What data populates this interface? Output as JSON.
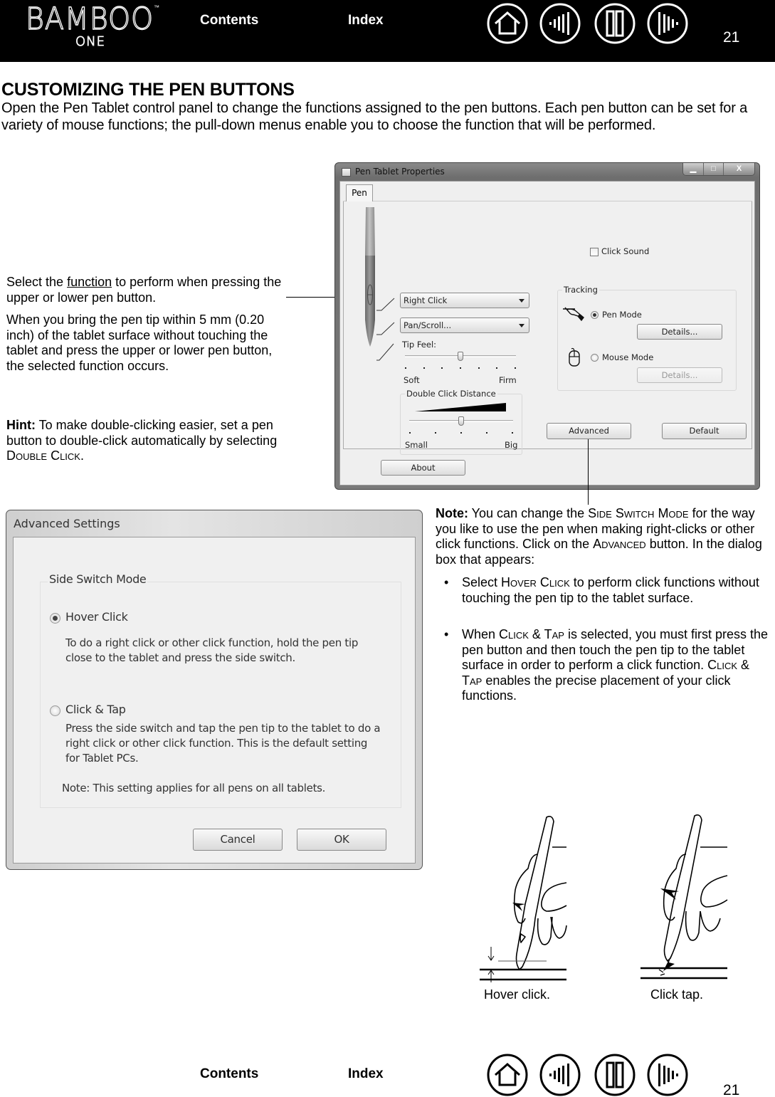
{
  "header": {
    "logo_main": "BAMBOO",
    "logo_tm": "™",
    "logo_sub": "ONE",
    "contents_label": "Contents",
    "index_label": "Index",
    "page_number": "21",
    "nav_icons": [
      "home-icon",
      "previous-page-icon",
      "contents-book-icon",
      "next-page-icon"
    ]
  },
  "page": {
    "title": "CUSTOMIZING THE PEN BUTTONS",
    "intro": "Open the Pen Tablet control panel to change the functions assigned to the pen buttons.  Each pen button can be set for a variety of mouse functions; the pull-down menus enable you to choose the function that will be performed."
  },
  "left_notes": {
    "select_prefix": "Select the ",
    "select_link": "function",
    "select_suffix": " to perform when pressing  the upper or lower pen button.",
    "hover_para": "When you bring the pen tip within 5 mm (0.20 inch) of the tablet surface without touching the tablet and press the upper or lower pen button, the selected function occurs.",
    "hint_label": "Hint:",
    "hint_text": " To make double-clicking easier, set a pen button to double-click automatically by selecting ",
    "hint_sc": "Double Click",
    "hint_end": "."
  },
  "pen_window": {
    "title": "Pen Tablet Properties",
    "controls": {
      "minimize": "▁",
      "maximize": "□",
      "close": "X"
    },
    "tab": "Pen",
    "click_sound_label": "Click Sound",
    "click_sound_checked": false,
    "upper_button": "Right Click",
    "lower_button": "Pan/Scroll...",
    "tip_feel_label": "Tip Feel:",
    "tip_feel_min": "Soft",
    "tip_feel_max": "Firm",
    "tip_feel_value": 0.5,
    "tip_feel_ticks": 7,
    "double_click_label": "Double Click Distance",
    "double_click_min": "Small",
    "double_click_max": "Big",
    "double_click_value": 0.5,
    "double_click_ticks": 5,
    "tracking_label": "Tracking",
    "pen_mode_label": "Pen Mode",
    "pen_mode_selected": true,
    "mouse_mode_label": "Mouse Mode",
    "details_label": "Details...",
    "advanced_label": "Advanced",
    "default_label": "Default",
    "about_label": "About"
  },
  "advanced_dialog": {
    "title": "Advanced Settings",
    "group_label": "Side Switch Mode",
    "hover_click_label": "Hover Click",
    "hover_click_desc": "To do a right click or other click function, hold the pen tip close to the tablet and press the side switch.",
    "click_tap_label": "Click & Tap",
    "click_tap_desc": "Press the side switch and tap the pen tip to the tablet to do a right click or other click function. This is the default setting for Tablet PCs.",
    "selected": "Hover Click",
    "note": "Note: This setting applies for all pens on all tablets.",
    "cancel_label": "Cancel",
    "ok_label": "OK"
  },
  "right_notes": {
    "note_label": "Note:",
    "note_a": " You can change the ",
    "note_sc1": "Side Switch Mode",
    "note_b": " for the way you like to use the pen when making right-clicks or other click functions.  Click on the ",
    "note_sc2": "Advanced",
    "note_c": " button.  In the dialog box that appears:",
    "bullet_char": "•",
    "b1_a": "Select ",
    "b1_sc": "Hover Click",
    "b1_b": " to perform click functions without touching the pen tip to the tablet surface.",
    "b2_a": "When ",
    "b2_sc1": "Click & Tap",
    "b2_b": " is selected, you must first press the pen button and then touch the pen tip to the tablet surface in order to perform a click function.  ",
    "b2_sc2": "Click & Tap",
    "b2_c": " enables the precise placement of your click functions."
  },
  "illustrations": {
    "hover_caption": "Hover click.",
    "tap_caption": "Click tap."
  },
  "footer": {
    "contents_label": "Contents",
    "index_label": "Index",
    "page_number": "21"
  }
}
